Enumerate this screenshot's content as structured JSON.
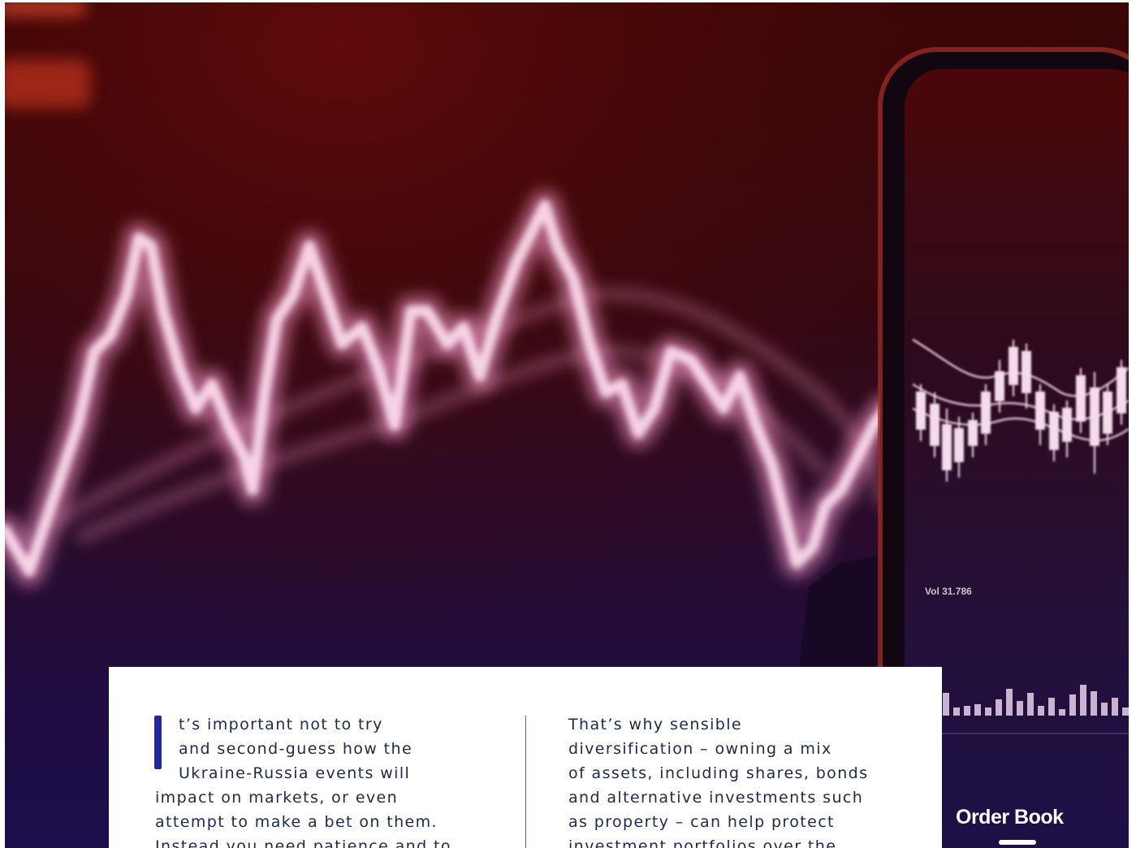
{
  "hero": {
    "phone_volume_label": "Vol 31.786",
    "phone_tab_label": "Order Book"
  },
  "article": {
    "column1_lines": [
      "t’s important not to try",
      "and second-guess how the",
      "Ukraine-Russia events will",
      "impact on markets, or even",
      "attempt to make a bet on them.",
      "Instead you need patience and to"
    ],
    "column2_lines": [
      "That’s why sensible",
      "diversification – owning a mix",
      "of assets, including shares, bonds",
      "and alternative investments such",
      "as property – can help protect",
      "investment portfolios over the"
    ]
  }
}
